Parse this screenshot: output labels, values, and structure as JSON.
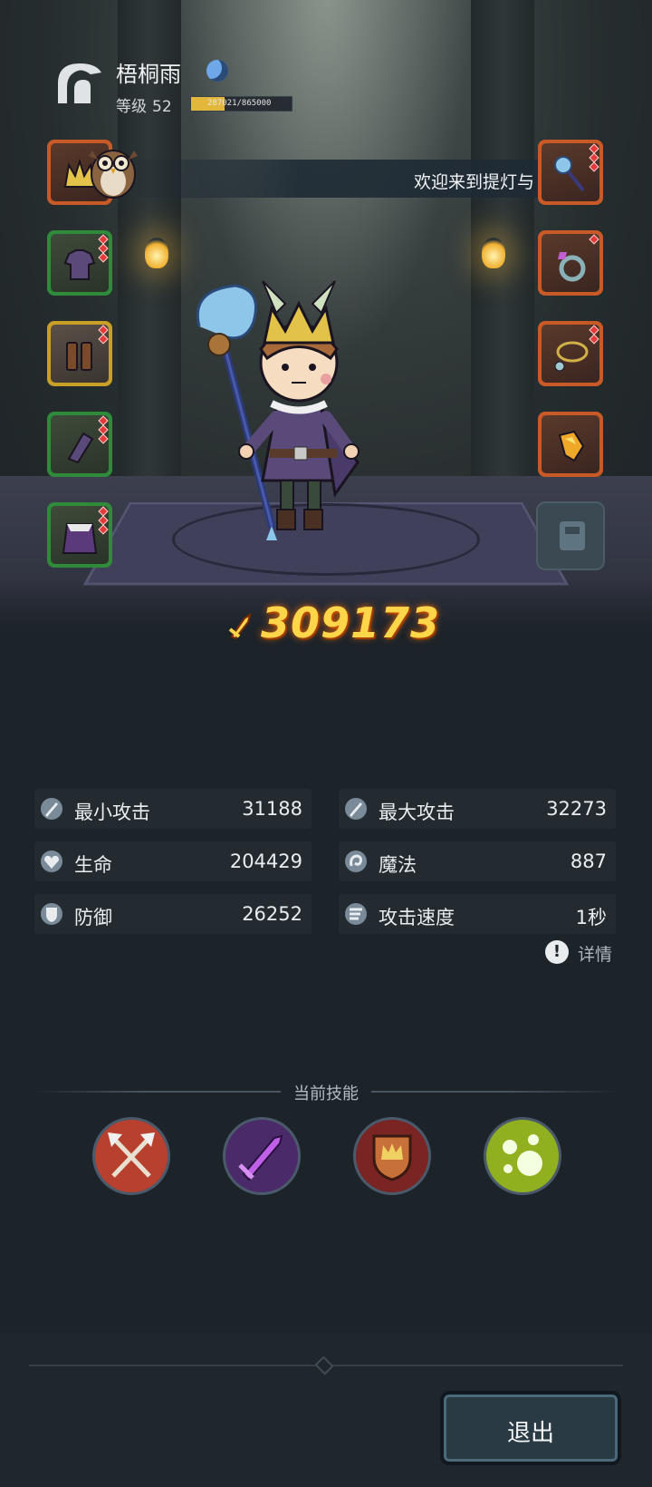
{
  "player": {
    "name": "梧桐雨",
    "level_label": "等级",
    "level": "52",
    "xp_text": "287021/865000",
    "xp_fraction": 0.33
  },
  "banner": {
    "text": "欢迎来到提灯与"
  },
  "equipment": {
    "left": [
      {
        "name": "helmet",
        "rarity": "orange"
      },
      {
        "name": "armor",
        "rarity": "green"
      },
      {
        "name": "boots",
        "rarity": "brown"
      },
      {
        "name": "gauntlet",
        "rarity": "green"
      },
      {
        "name": "cloak",
        "rarity": "green"
      }
    ],
    "right": [
      {
        "name": "staff",
        "rarity": "orange"
      },
      {
        "name": "ring",
        "rarity": "orange"
      },
      {
        "name": "necklace",
        "rarity": "orange"
      },
      {
        "name": "amulet",
        "rarity": "orange"
      }
    ]
  },
  "power": {
    "value": "309173"
  },
  "stats": {
    "min_attack": {
      "label": "最小攻击",
      "value": "31188"
    },
    "max_attack": {
      "label": "最大攻击",
      "value": "32273"
    },
    "hp": {
      "label": "生命",
      "value": "204429"
    },
    "mp": {
      "label": "魔法",
      "value": "887"
    },
    "defense": {
      "label": "防御",
      "value": "26252"
    },
    "attack_speed": {
      "label": "攻击速度",
      "value": "1秒"
    }
  },
  "details": {
    "label": "详情"
  },
  "skills": {
    "title": "当前技能",
    "items": [
      {
        "icon": "crossed-axes-icon",
        "color": "#b8402e"
      },
      {
        "icon": "purple-sword-icon",
        "color": "#5a2a78"
      },
      {
        "icon": "shield-crown-icon",
        "color": "#8a2a2a"
      },
      {
        "icon": "green-orbs-icon",
        "color": "#8ab020"
      }
    ]
  },
  "exit": {
    "label": "退出"
  },
  "colors": {
    "power": "#ffd64a",
    "accent": "#e3b73c",
    "panel": "#232b31",
    "background": "#1c2329"
  }
}
